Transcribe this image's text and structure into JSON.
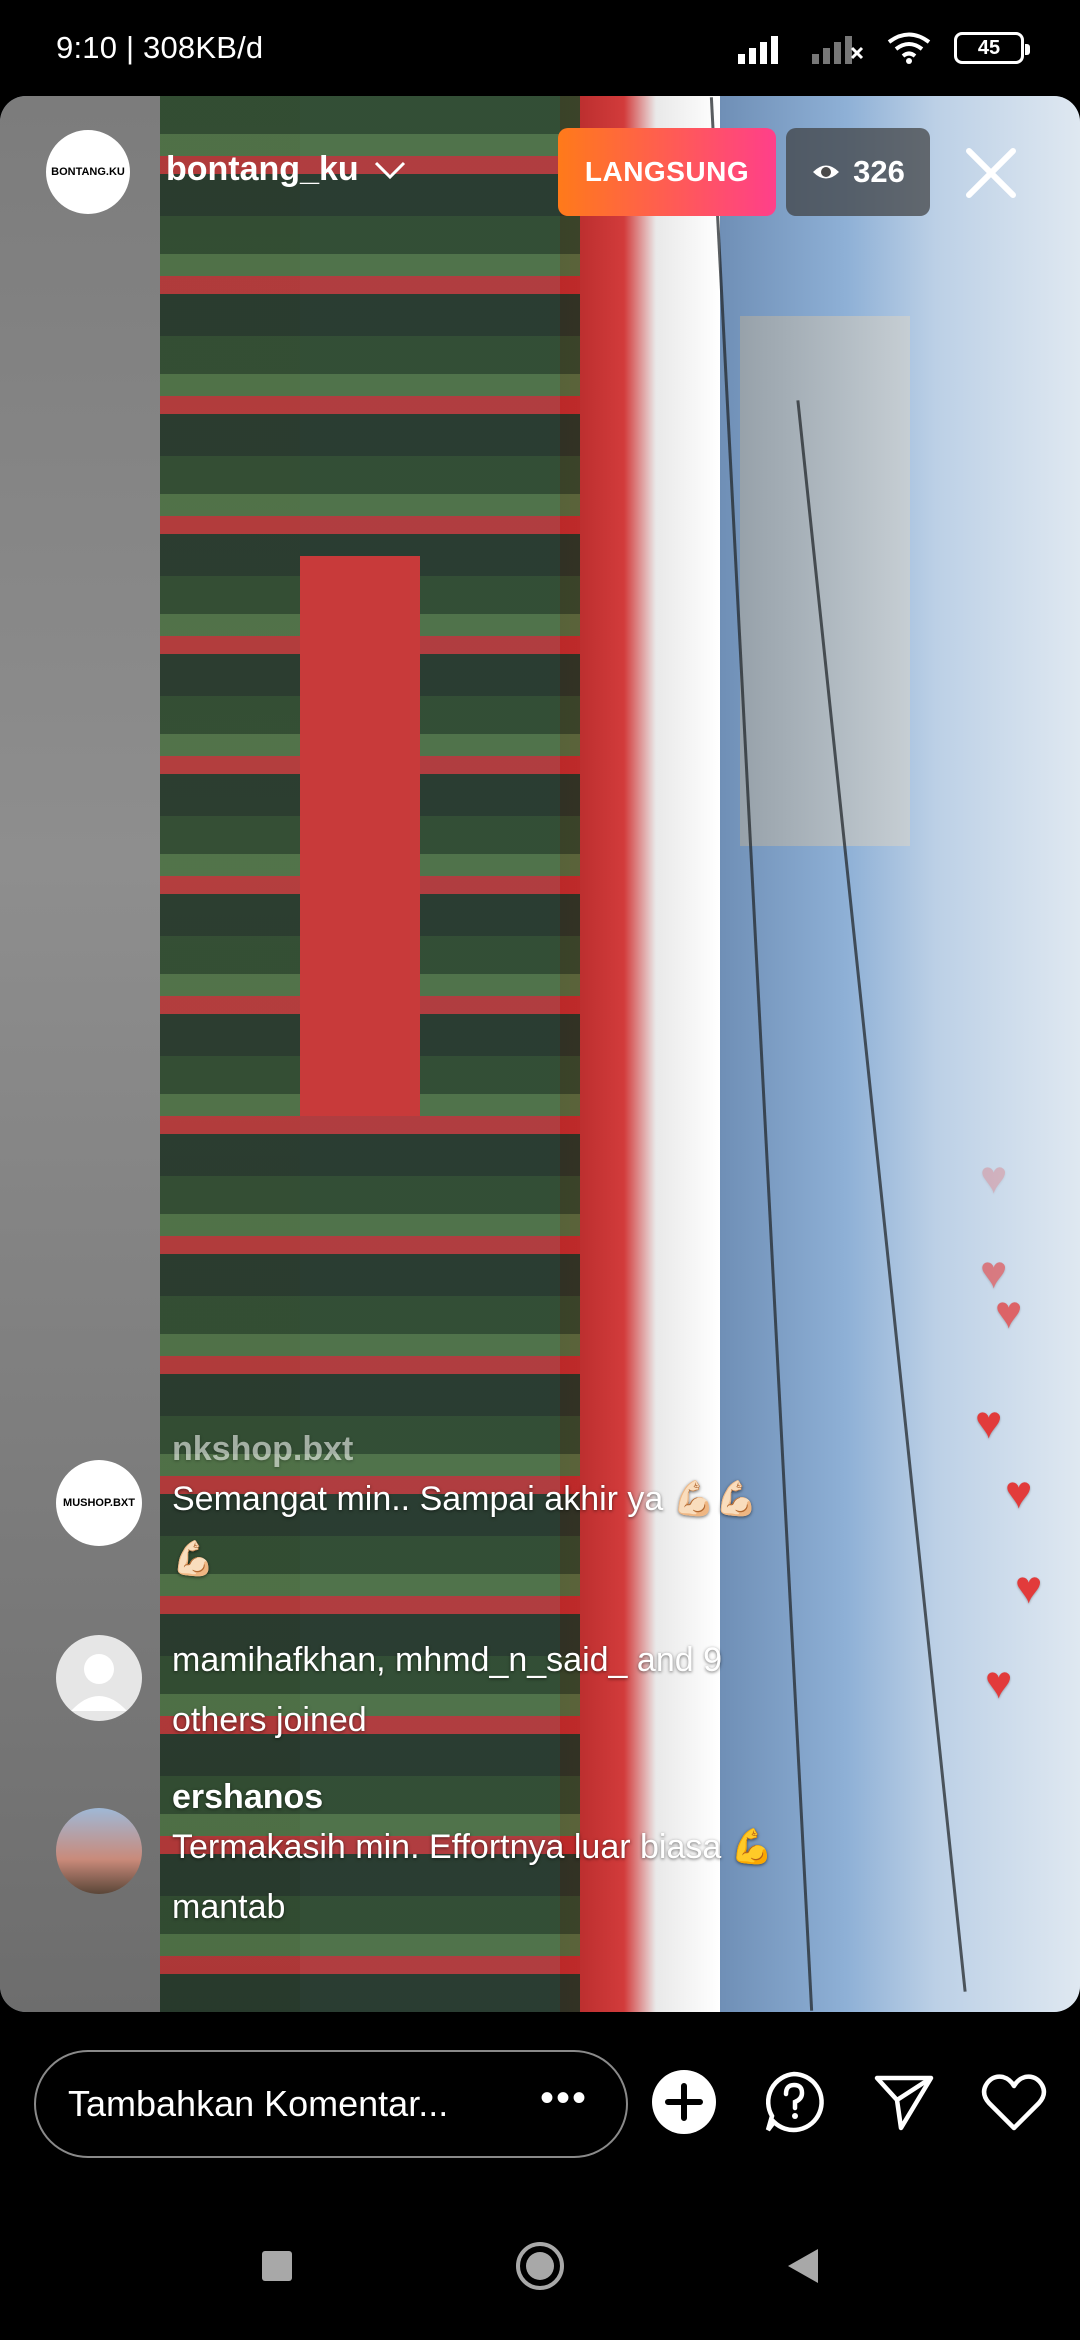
{
  "status_bar": {
    "time": "9:10 | 308KB/d",
    "battery": "45"
  },
  "live": {
    "avatar_text": "BONTANG.KU",
    "username": "bontang_ku",
    "live_label": "LANGSUNG",
    "viewer_count": "326"
  },
  "comments": [
    {
      "user": "nkshop.bxt",
      "avatar_text": "MUSHOP.BXT",
      "text": "Semangat min.. Sampai akhir ya 💪🏻💪🏻",
      "text2": "💪🏻"
    },
    {
      "user": "",
      "text": "mamihafkhan, mhmd_n_said_ and 9",
      "text2": "others joined"
    },
    {
      "user": "ershanos",
      "text": "Termakasih min. Effortnya luar biasa 💪",
      "text2": "mantab"
    }
  ],
  "bottom_bar": {
    "comment_placeholder": "Tambahkan Komentar...",
    "more": "•••"
  },
  "colors": {
    "live_gradient_start": "#ff7a1a",
    "live_gradient_end": "#ff3f8a",
    "heart": "#e23b3b"
  }
}
